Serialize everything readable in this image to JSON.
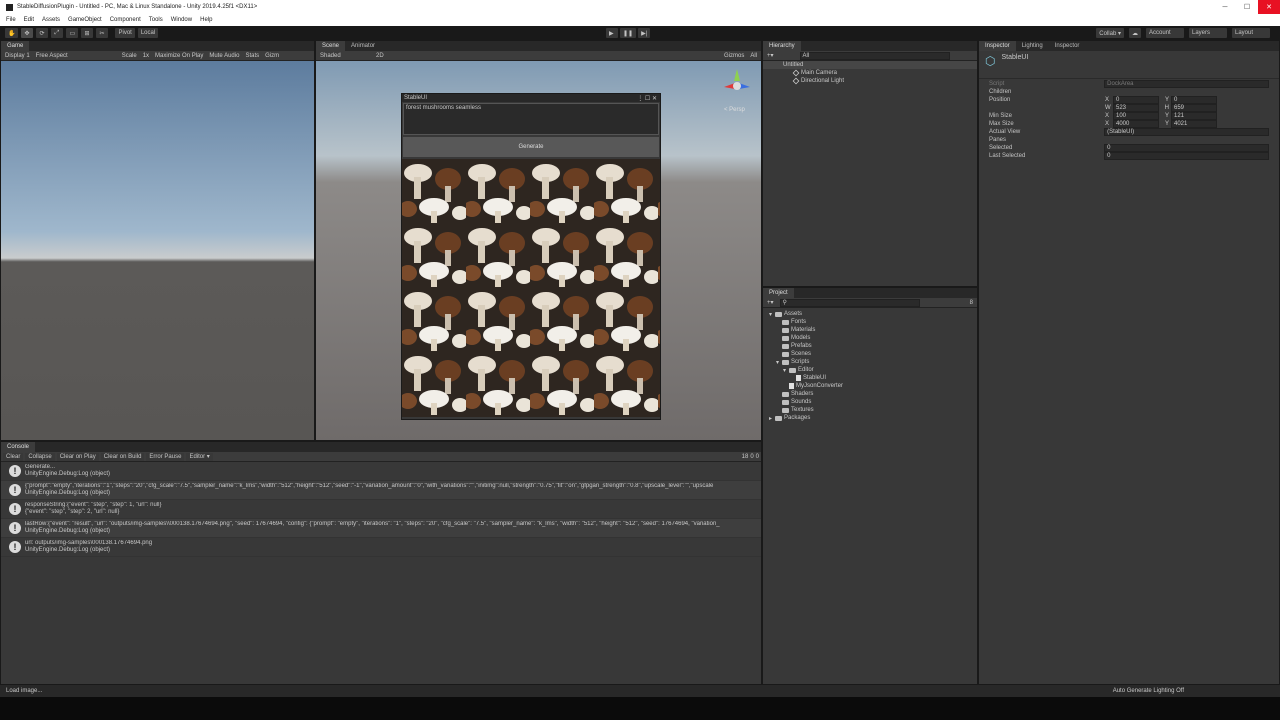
{
  "window": {
    "title": "StableDiffusionPlugin - Untitled - PC, Mac & Linux Standalone - Unity 2019.4.25f1 <DX11>",
    "min": "─",
    "max": "☐",
    "close": "✕"
  },
  "menu": [
    "File",
    "Edit",
    "Assets",
    "GameObject",
    "Component",
    "Tools",
    "Window",
    "Help"
  ],
  "toolbar": {
    "tools": [
      "✋",
      "✥",
      "⟳",
      "⤢",
      "▭",
      "⊞",
      "✂"
    ],
    "pivot": "Pivot",
    "local": "Local",
    "play": "▶",
    "pause": "❚❚",
    "step": "▶|",
    "collab": "Collab ▾",
    "cloud": "☁",
    "account": "Account",
    "layers": "Layers",
    "layout": "Layout"
  },
  "game": {
    "tab": "Game",
    "display": "Display 1",
    "aspect": "Free Aspect",
    "scale_label": "Scale",
    "scale_value": "1x",
    "maximize": "Maximize On Play",
    "mute": "Mute Audio",
    "stats": "Stats",
    "gizmos": "Gizm"
  },
  "scene": {
    "tab": "Scene",
    "animator_tab": "Animator",
    "shading": "Shaded",
    "mode2d": "2D",
    "gizmos": "Gizmos",
    "search": "All",
    "persp": "< Persp"
  },
  "stableui": {
    "title": "StableUI",
    "prompt": "forest mushrooms seamless",
    "generate": "Generate"
  },
  "hierarchy": {
    "tab": "Hierarchy",
    "search": "All",
    "scene": "Untitled",
    "items": [
      "Main Camera",
      "Directional Light"
    ]
  },
  "project": {
    "tab": "Project",
    "count": "8",
    "tree": [
      {
        "label": "Assets",
        "depth": 0,
        "type": "folder",
        "open": true
      },
      {
        "label": "Fonts",
        "depth": 1,
        "type": "folder"
      },
      {
        "label": "Materials",
        "depth": 1,
        "type": "folder"
      },
      {
        "label": "Models",
        "depth": 1,
        "type": "folder"
      },
      {
        "label": "Prefabs",
        "depth": 1,
        "type": "folder"
      },
      {
        "label": "Scenes",
        "depth": 1,
        "type": "folder"
      },
      {
        "label": "Scripts",
        "depth": 1,
        "type": "folder",
        "open": true
      },
      {
        "label": "Editor",
        "depth": 2,
        "type": "folder",
        "open": true
      },
      {
        "label": "StableUI",
        "depth": 3,
        "type": "script"
      },
      {
        "label": "MyJsonConverter",
        "depth": 2,
        "type": "script"
      },
      {
        "label": "Shaders",
        "depth": 1,
        "type": "folder"
      },
      {
        "label": "Sounds",
        "depth": 1,
        "type": "folder"
      },
      {
        "label": "Textures",
        "depth": 1,
        "type": "folder"
      },
      {
        "label": "Packages",
        "depth": 0,
        "type": "folder"
      }
    ]
  },
  "inspector": {
    "tabs": [
      "Inspector",
      "Lighting",
      "Inspector"
    ],
    "object": "StableUI",
    "script_label": "Script",
    "script_value": "DockArea",
    "children": "Children",
    "position": "Position",
    "pos_x": "0",
    "pos_y": "0",
    "pos_w": "523",
    "pos_h": "659",
    "min_size": "Min Size",
    "min_x": "100",
    "min_y": "121",
    "max_size": "Max Size",
    "max_x": "4000",
    "max_y": "4021",
    "actual_view": "Actual View",
    "actual_value": "(StableUI)",
    "panes": "Panes",
    "selected": "Selected",
    "selected_value": "0",
    "last_selected": "Last Selected",
    "last_selected_value": "0",
    "x": "X",
    "y": "Y",
    "w": "W",
    "h": "H"
  },
  "console": {
    "tab": "Console",
    "buttons": [
      "Clear",
      "Collapse",
      "Clear on Play",
      "Clear on Build",
      "Error Pause",
      "Editor ▾"
    ],
    "info_count": "18",
    "warn_count": "0",
    "error_count": "0",
    "logs": [
      {
        "l1": "Generate...",
        "l2": "UnityEngine.Debug:Log (object)"
      },
      {
        "l1": "{\"prompt\":\"empty\",\"iterations\":\"1\",\"steps\":\"20\",\"cfg_scale\":\"7.5\",\"sampler_name\":\"k_lms\",\"width\":\"512\",\"height\":\"512\",\"seed\":\"-1\",\"variation_amount\":\"0\",\"with_variations\":\"\",\"initimg\":null,\"strength\":\"0.75\",\"fit\":\"on\",\"gfpgan_strength\":\"0.8\",\"upscale_level\":\"\",\"upscale",
        "l2": "UnityEngine.Debug:Log (object)"
      },
      {
        "l1": "responseString:{\"event\": \"step\", \"step\": 1, \"url\": null}",
        "l2": "{\"event\": \"step\", \"step\": 2, \"url\": null}"
      },
      {
        "l1": "lastRow:{\"event\": \"result\", \"url\": \"outputs/img-samples\\\\000138.17674694.png\", \"seed\": 17674694, \"config\": {\"prompt\": \"empty\", \"iterations\": \"1\", \"steps\": \"20\", \"cfg_scale\": \"7.5\", \"sampler_name\": \"k_lms\", \"width\": \"512\", \"height\": \"512\", \"seed\": 17674694, \"variation_",
        "l2": "UnityEngine.Debug:Log (object)"
      },
      {
        "l1": "url: outputs/img-samples\\000138.17674694.png",
        "l2": "UnityEngine.Debug:Log (object)"
      }
    ]
  },
  "status": {
    "left": "Load image...",
    "right": "Auto Generate Lighting Off"
  }
}
